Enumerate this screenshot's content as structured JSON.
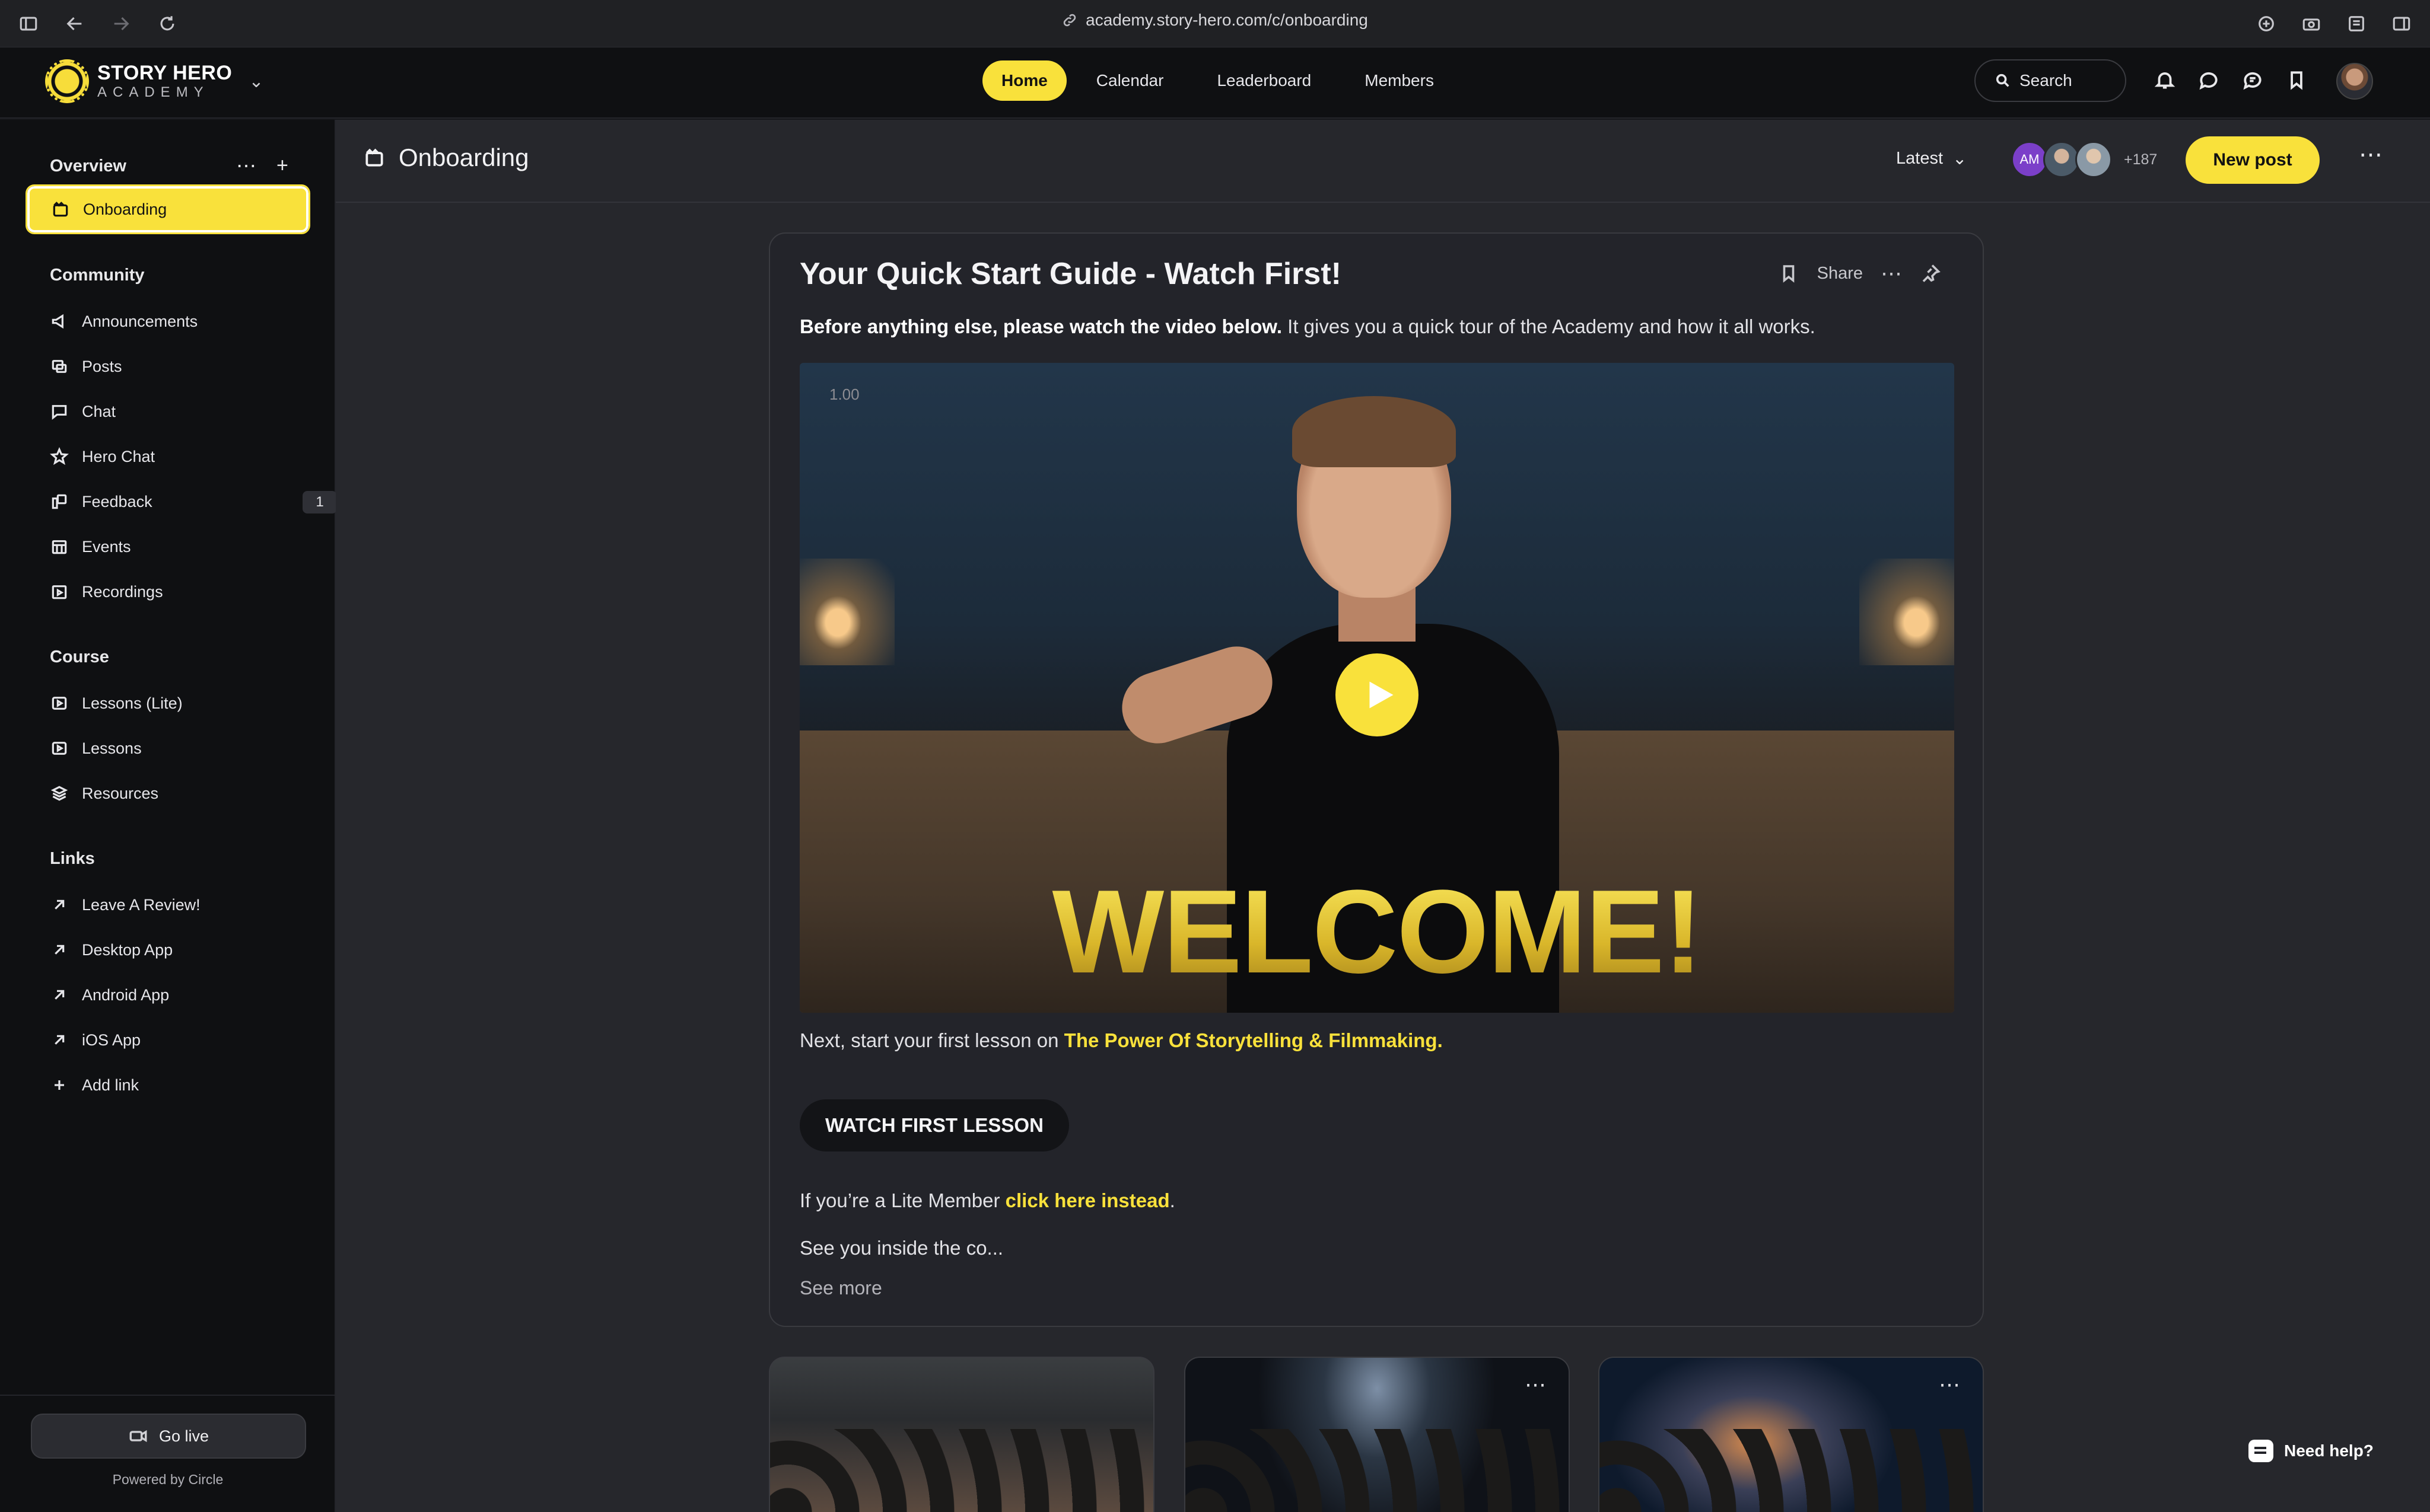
{
  "browser": {
    "url": "academy.story-hero.com/c/onboarding"
  },
  "brand": {
    "name_line1": "STORY HERO",
    "name_line2": "ACADEMY",
    "accent_color": "#f9e13b"
  },
  "top_nav": {
    "items": [
      "Home",
      "Calendar",
      "Leaderboard",
      "Members"
    ],
    "active": "Home",
    "search_label": "Search"
  },
  "sidebar": {
    "overview": {
      "title": "Overview",
      "items": [
        {
          "label": "Onboarding",
          "icon": "clapper-icon",
          "active": true
        }
      ]
    },
    "community": {
      "title": "Community",
      "items": [
        {
          "label": "Announcements",
          "icon": "megaphone-icon"
        },
        {
          "label": "Posts",
          "icon": "posts-icon"
        },
        {
          "label": "Chat",
          "icon": "chat-icon"
        },
        {
          "label": "Hero Chat",
          "icon": "star-icon"
        },
        {
          "label": "Feedback",
          "icon": "feedback-icon",
          "badge": "1"
        },
        {
          "label": "Events",
          "icon": "calendar-icon"
        },
        {
          "label": "Recordings",
          "icon": "recording-icon"
        }
      ]
    },
    "course": {
      "title": "Course",
      "items": [
        {
          "label": "Lessons (Lite)",
          "icon": "play-square-icon"
        },
        {
          "label": "Lessons",
          "icon": "play-square-icon"
        },
        {
          "label": "Resources",
          "icon": "layers-icon"
        }
      ]
    },
    "links": {
      "title": "Links",
      "items": [
        {
          "label": "Leave A Review!",
          "icon": "arrow-up-right-icon"
        },
        {
          "label": "Desktop App",
          "icon": "arrow-up-right-icon"
        },
        {
          "label": "Android App",
          "icon": "arrow-up-right-icon"
        },
        {
          "label": "iOS App",
          "icon": "arrow-up-right-icon"
        },
        {
          "label": "Add link",
          "icon": "plus-icon"
        }
      ]
    },
    "go_live_label": "Go live",
    "powered_by": "Powered by Circle"
  },
  "main_header": {
    "title": "Onboarding",
    "sort_label": "Latest",
    "avatar_initials": "AM",
    "member_count": "+187",
    "new_post_label": "New post"
  },
  "post": {
    "title": "Your Quick Start Guide - Watch First!",
    "share_label": "Share",
    "intro_bold": "Before anything else, please watch the video below.",
    "intro_rest": " It gives you a quick tour of the Academy and how it all works.",
    "video_rate": "1.00",
    "video_overlay_text": "WELCOME!",
    "next_prefix": "Next, start your first lesson on ",
    "next_link": "The Power Of Storytelling & Filmmaking.",
    "button_label": "WATCH FIRST LESSON",
    "lite_prefix": "If you’re a Lite Member ",
    "lite_link": "click here instead",
    "lite_suffix": ".",
    "closing": "See you inside the co...",
    "see_more": "See more"
  },
  "help": {
    "label": "Need help?"
  }
}
